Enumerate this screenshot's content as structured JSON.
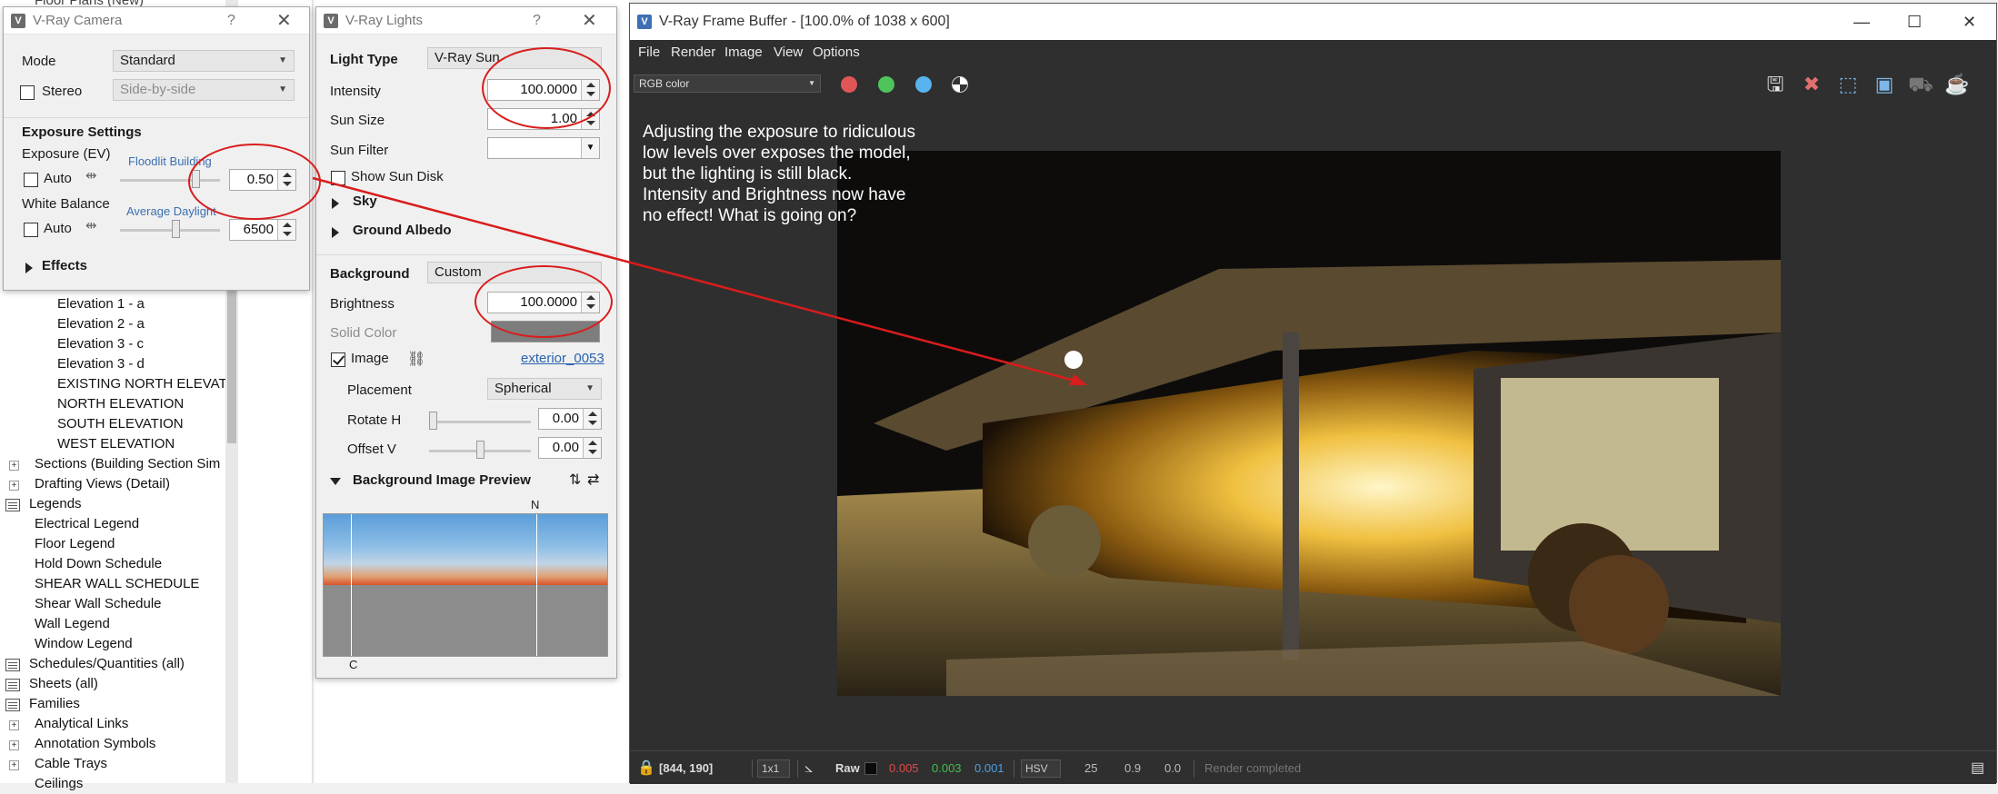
{
  "project_browser": {
    "cut_top_item": "Floor Plans (New)",
    "elevations": [
      "Elevation 1 - a",
      "Elevation 2 - a",
      "Elevation 3 - c",
      "Elevation 3 - d",
      "EXISTING NORTH ELEVATIO",
      "NORTH ELEVATION",
      "SOUTH ELEVATION",
      "WEST ELEVATION"
    ],
    "groups": [
      "Sections (Building Section Sim",
      "Drafting Views (Detail)"
    ],
    "legends_label": "Legends",
    "legends": [
      "Electrical Legend",
      "Floor Legend",
      "Hold Down Schedule",
      "SHEAR WALL SCHEDULE",
      "Shear Wall Schedule",
      "Wall Legend",
      "Window Legend"
    ],
    "schedules": "Schedules/Quantities (all)",
    "sheets": "Sheets (all)",
    "families": "Families",
    "family_items": [
      "Analytical Links",
      "Annotation Symbols",
      "Cable Trays",
      "Ceilings"
    ]
  },
  "camera": {
    "title": "V-Ray Camera",
    "help": "?",
    "close": "✕",
    "mode_label": "Mode",
    "mode_value": "Standard",
    "stereo_label": "Stereo",
    "stereo_value": "Side-by-side",
    "exposure_heading": "Exposure Settings",
    "exposure_label": "Exposure (EV)",
    "exposure_preset": "Floodlit Building",
    "auto_label": "Auto",
    "exposure_value": "0.50",
    "exposure_slider_level": 0.75,
    "wb_label": "White Balance",
    "wb_preset": "Average Daylight",
    "wb_value": "6500",
    "wb_slider_level": 0.55,
    "effects_label": "Effects"
  },
  "lights": {
    "title": "V-Ray Lights",
    "help": "?",
    "close": "✕",
    "light_type_label": "Light Type",
    "light_type_value": "V-Ray Sun",
    "intensity_label": "Intensity",
    "intensity_value": "100.0000",
    "sun_size_label": "Sun Size",
    "sun_size_value": "1.00",
    "sun_filter_label": "Sun Filter",
    "show_sun_disk_label": "Show Sun Disk",
    "sky_label": "Sky",
    "ground_albedo_label": "Ground Albedo",
    "background_label": "Background",
    "background_value": "Custom",
    "brightness_label": "Brightness",
    "brightness_value": "100.0000",
    "solid_color_label": "Solid Color",
    "image_label": "Image",
    "image_link": "exterior_0053",
    "placement_label": "Placement",
    "placement_value": "Spherical",
    "rotate_h_label": "Rotate H",
    "rotate_h_value": "0.00",
    "offset_v_label": "Offset V",
    "offset_v_value": "0.00",
    "offset_v_slider_level": 0.5,
    "preview_label": "Background Image Preview",
    "compass_n": "N",
    "compass_c": "C"
  },
  "vfb": {
    "title": "V-Ray Frame Buffer - [100.0% of 1038 x 600]",
    "menu": [
      "File",
      "Render",
      "Image",
      "View",
      "Options"
    ],
    "channel": "RGB color",
    "annotation": "Adjusting the exposure to ridiculous low levels over exposes the model, but the lighting is still black.  Intensity and Brightness now have no effect!  What is going on?",
    "status": {
      "coords": "[844, 190]",
      "zoom": "1x1",
      "raw": "Raw",
      "r": "0.005",
      "g": "0.003",
      "b": "0.001",
      "mode": "HSV",
      "h": "25",
      "s": "0.9",
      "v": "0.0",
      "message": "Render completed"
    }
  },
  "colors": {
    "red_annotation": "#d91c1c",
    "vfb_bg": "#2f2f2f",
    "status_r": "#e04a4a",
    "status_g": "#3fc24a",
    "status_b": "#4aa0e6"
  }
}
